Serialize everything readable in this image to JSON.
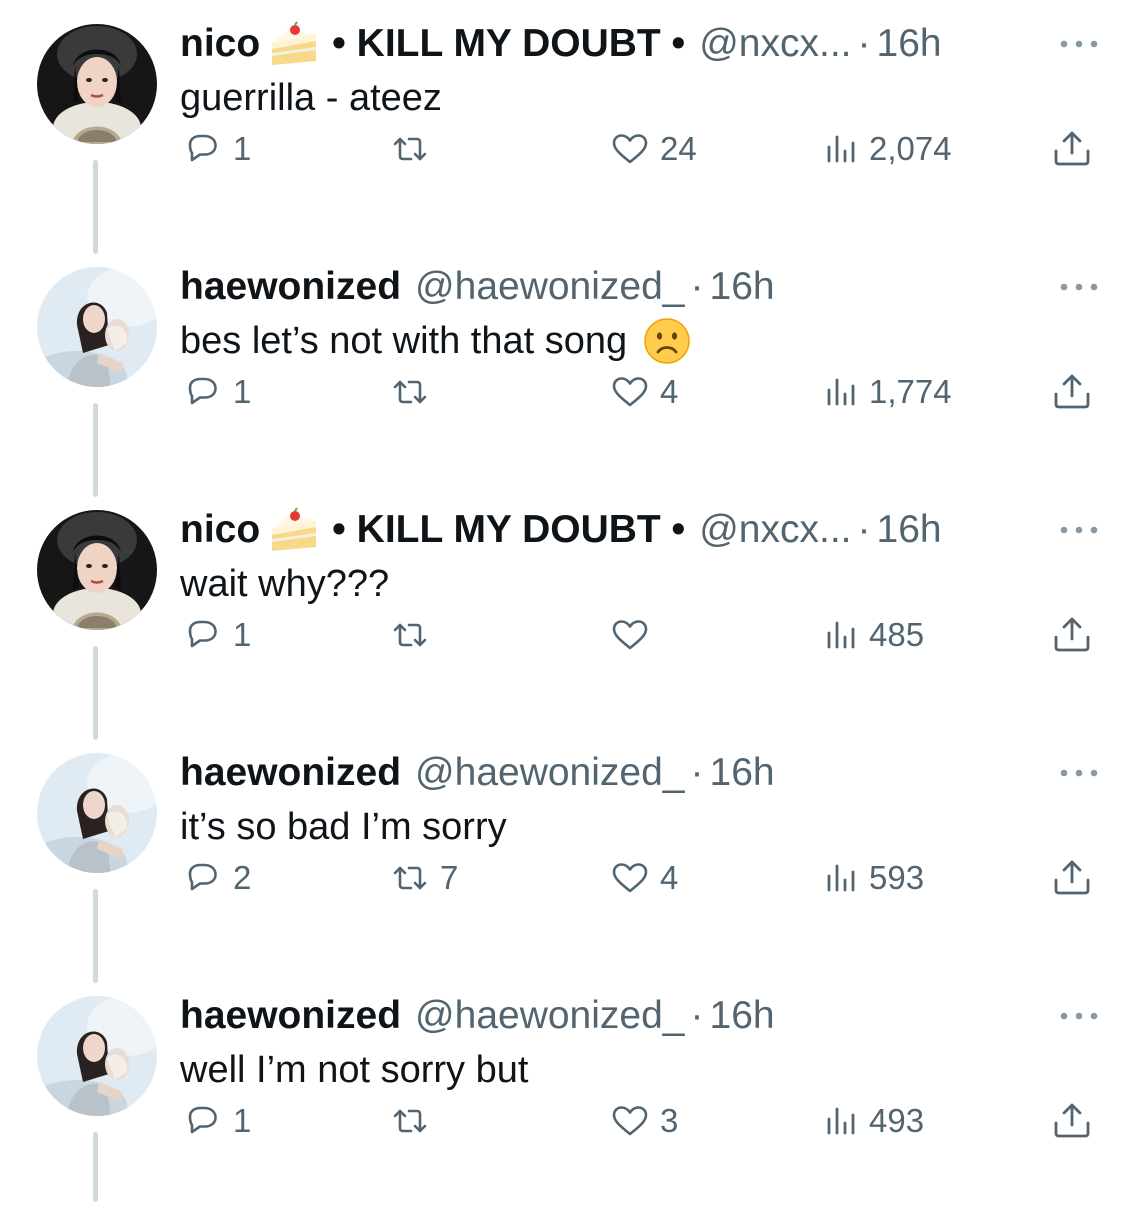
{
  "tweets": [
    {
      "name": "nico",
      "name_emoji": "cake-emoji",
      "name_suffix": "• KILL MY DOUBT •",
      "handle": "@nxcx...",
      "separator": "·",
      "time": "16h",
      "text": "guerrilla -  ateez",
      "reply_count": "1",
      "retweet_count": "",
      "like_count": "24",
      "view_count": "2,074"
    },
    {
      "name": "haewonized",
      "handle": "@haewonized_",
      "separator": "·",
      "time": "16h",
      "text": "bes let’s not with that song",
      "text_emoji": "slightly-frowning-face-emoji",
      "reply_count": "1",
      "retweet_count": "",
      "like_count": "4",
      "view_count": "1,774"
    },
    {
      "name": "nico",
      "name_emoji": "cake-emoji",
      "name_suffix": "• KILL MY DOUBT •",
      "handle": "@nxcx...",
      "separator": "·",
      "time": "16h",
      "text": "wait why???",
      "reply_count": "1",
      "retweet_count": "",
      "like_count": "",
      "view_count": "485"
    },
    {
      "name": "haewonized",
      "handle": "@haewonized_",
      "separator": "·",
      "time": "16h",
      "text": "it’s so bad I’m sorry",
      "reply_count": "2",
      "retweet_count": "7",
      "like_count": "4",
      "view_count": "593"
    },
    {
      "name": "haewonized",
      "handle": "@haewonized_",
      "separator": "·",
      "time": "16h",
      "text": "well I’m not sorry but",
      "reply_count": "1",
      "retweet_count": "",
      "like_count": "3",
      "view_count": "493"
    }
  ],
  "colors": {
    "text_primary": "#0f1419",
    "text_secondary": "#536471",
    "thread_line": "#cfd9de"
  },
  "icons": {
    "reply": "reply-icon",
    "retweet": "retweet-icon",
    "like": "heart-icon",
    "views": "views-icon",
    "share": "share-icon",
    "more": "more-options-icon"
  }
}
